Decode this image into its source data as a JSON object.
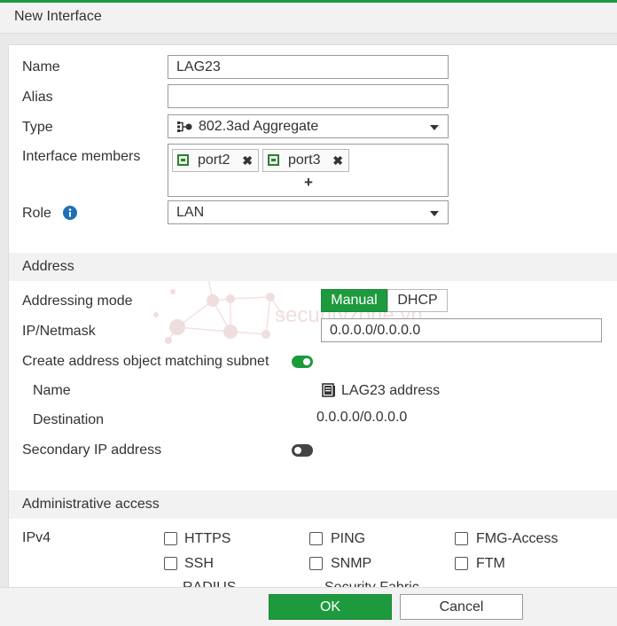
{
  "dialog": {
    "title": "New Interface"
  },
  "form": {
    "name_label": "Name",
    "name_value": "LAG23",
    "alias_label": "Alias",
    "alias_value": "",
    "type_label": "Type",
    "type_value": "802.3ad Aggregate",
    "members_label": "Interface members",
    "members": [
      "port2",
      "port3"
    ],
    "add_symbol": "+",
    "role_label": "Role",
    "role_value": "LAN"
  },
  "address": {
    "header": "Address",
    "mode_label": "Addressing mode",
    "modes": [
      "Manual",
      "DHCP"
    ],
    "ipmask_label": "IP/Netmask",
    "ipmask_value": "0.0.0.0/0.0.0.0",
    "create_obj_label": "Create address object matching subnet",
    "create_obj_enabled": true,
    "obj_name_label": "Name",
    "obj_name_value": "LAG23 address",
    "destination_label": "Destination",
    "destination_value": "0.0.0.0/0.0.0.0",
    "secondary_label": "Secondary IP address",
    "secondary_enabled": false
  },
  "admin_access": {
    "header": "Administrative access",
    "ipv4_label": "IPv4",
    "options": [
      "HTTPS",
      "PING",
      "FMG-Access",
      "SSH",
      "SNMP",
      "FTM",
      "RADIUS",
      "Security Fabric"
    ]
  },
  "watermark": "securityzone.vn",
  "buttons": {
    "ok": "OK",
    "cancel": "Cancel"
  },
  "colors": {
    "accent": "#1e9a3e",
    "info": "#1f6fb5"
  }
}
